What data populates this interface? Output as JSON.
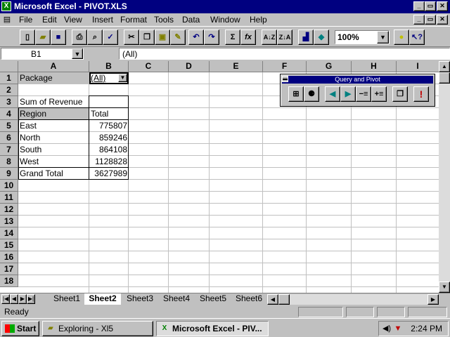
{
  "window": {
    "title": "Microsoft Excel - PIVOT.XLS"
  },
  "caption_buttons": {
    "minimize": "_",
    "restore": "▭",
    "close": "✕"
  },
  "menu": [
    "File",
    "Edit",
    "View",
    "Insert",
    "Format",
    "Tools",
    "Data",
    "Window",
    "Help"
  ],
  "toolbar": {
    "zoom": "100%"
  },
  "formula_bar": {
    "name_box": "B1",
    "content": "(All)"
  },
  "columns": [
    "A",
    "B",
    "C",
    "D",
    "E",
    "F",
    "G",
    "H",
    "I"
  ],
  "rows": [
    "1",
    "2",
    "3",
    "4",
    "5",
    "6",
    "7",
    "8",
    "9",
    "10",
    "11",
    "12",
    "13",
    "14",
    "15",
    "16",
    "17",
    "18"
  ],
  "cells": {
    "a1": "Package",
    "b1": "(All)",
    "a3": "Sum of Revenue",
    "a4": "Region",
    "b4": "Total",
    "a5": "East",
    "b5": "775807",
    "a6": "North",
    "b6": "859246",
    "a7": "South",
    "b7": "864108",
    "a8": "West",
    "b8": "1128828",
    "a9": "Grand Total",
    "b9": "3627989"
  },
  "query_pivot": {
    "title": "Query and Pivot"
  },
  "sheets": [
    "Sheet1",
    "Sheet2",
    "Sheet3",
    "Sheet4",
    "Sheet5",
    "Sheet6"
  ],
  "active_sheet": "Sheet2",
  "status": {
    "text": "Ready"
  },
  "taskbar": {
    "start": "Start",
    "tasks": [
      "Exploring - Xl5",
      "Microsoft Excel - PIV..."
    ],
    "clock": "2:24 PM"
  }
}
